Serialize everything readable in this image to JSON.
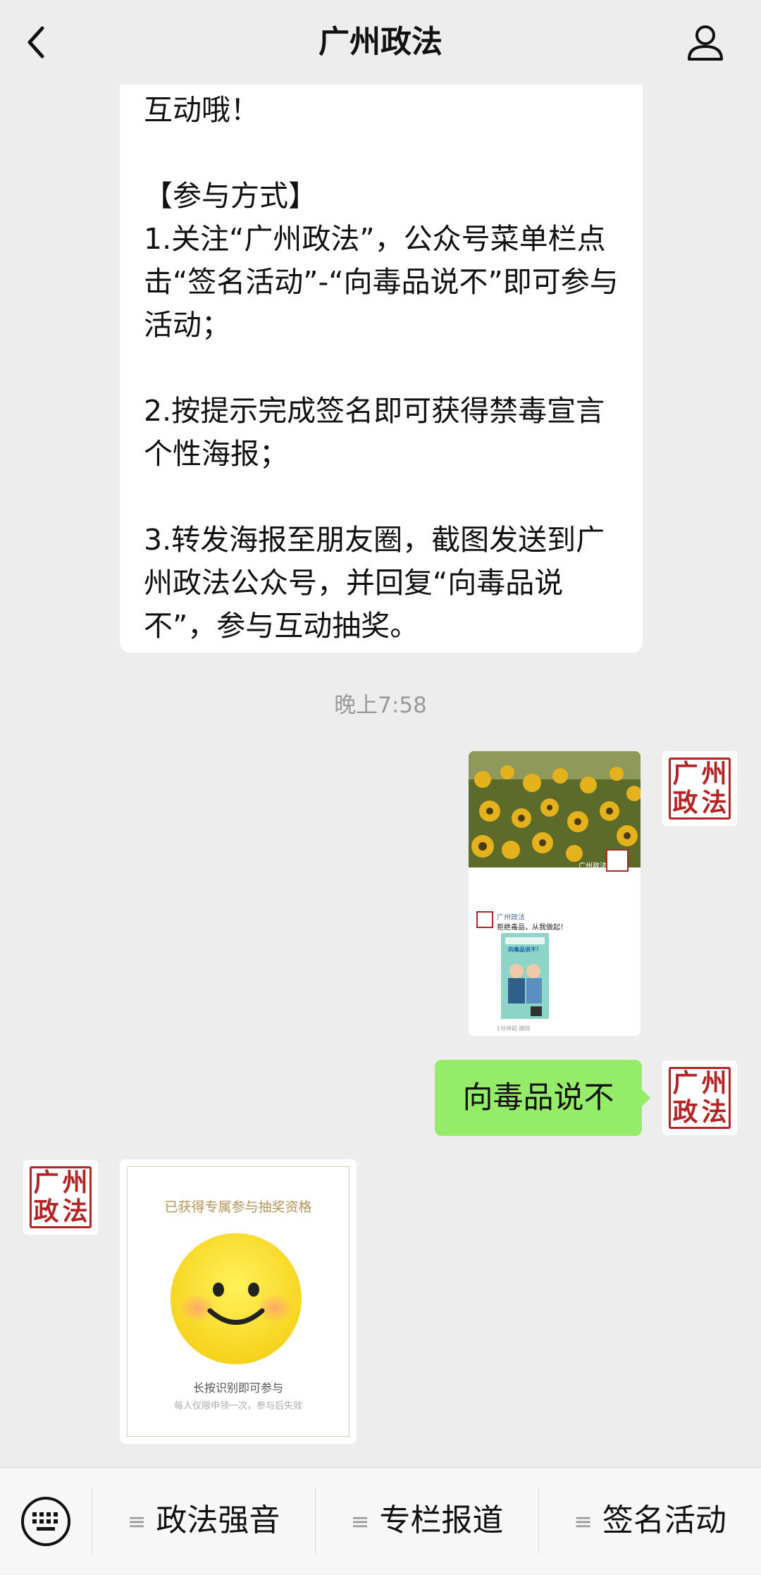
{
  "header": {
    "title": "广州政法"
  },
  "message": {
    "text": "互动哦！\n\n【参与方式】\n1.关注“广州政法”，公众号菜单栏点击“签名活动”-“向毒品说不”即可参与活动；\n\n2.按提示完成签名即可获得禁毒宣言个性海报；\n\n3.转发海报至朋友圈，截图发送到广州政法公众号，并回复“向毒品说不”，参与互动抽奖。"
  },
  "timestamp": "晚上7:58",
  "avatar": {
    "chars": [
      "广",
      "州",
      "政",
      "法"
    ]
  },
  "image_card": {
    "watermark": "广州政法",
    "account": "广州政法",
    "caption": "拒绝毒品，从我做起！",
    "poster_title": "向毒品说不！",
    "meta": "1分钟前  删除"
  },
  "sent_message": {
    "text": "向毒品说不"
  },
  "lottery": {
    "title": "已获得专属参与抽奖资格",
    "action": "长按识别即可参与",
    "note": "每人仅限申领一次，参与后失效"
  },
  "menu": {
    "items": [
      {
        "label": "政法强音"
      },
      {
        "label": "专栏报道"
      },
      {
        "label": "签名活动"
      }
    ]
  },
  "colors": {
    "sent_bubble": "#95ec69",
    "seal_red": "#b52424",
    "background": "#ededed"
  }
}
